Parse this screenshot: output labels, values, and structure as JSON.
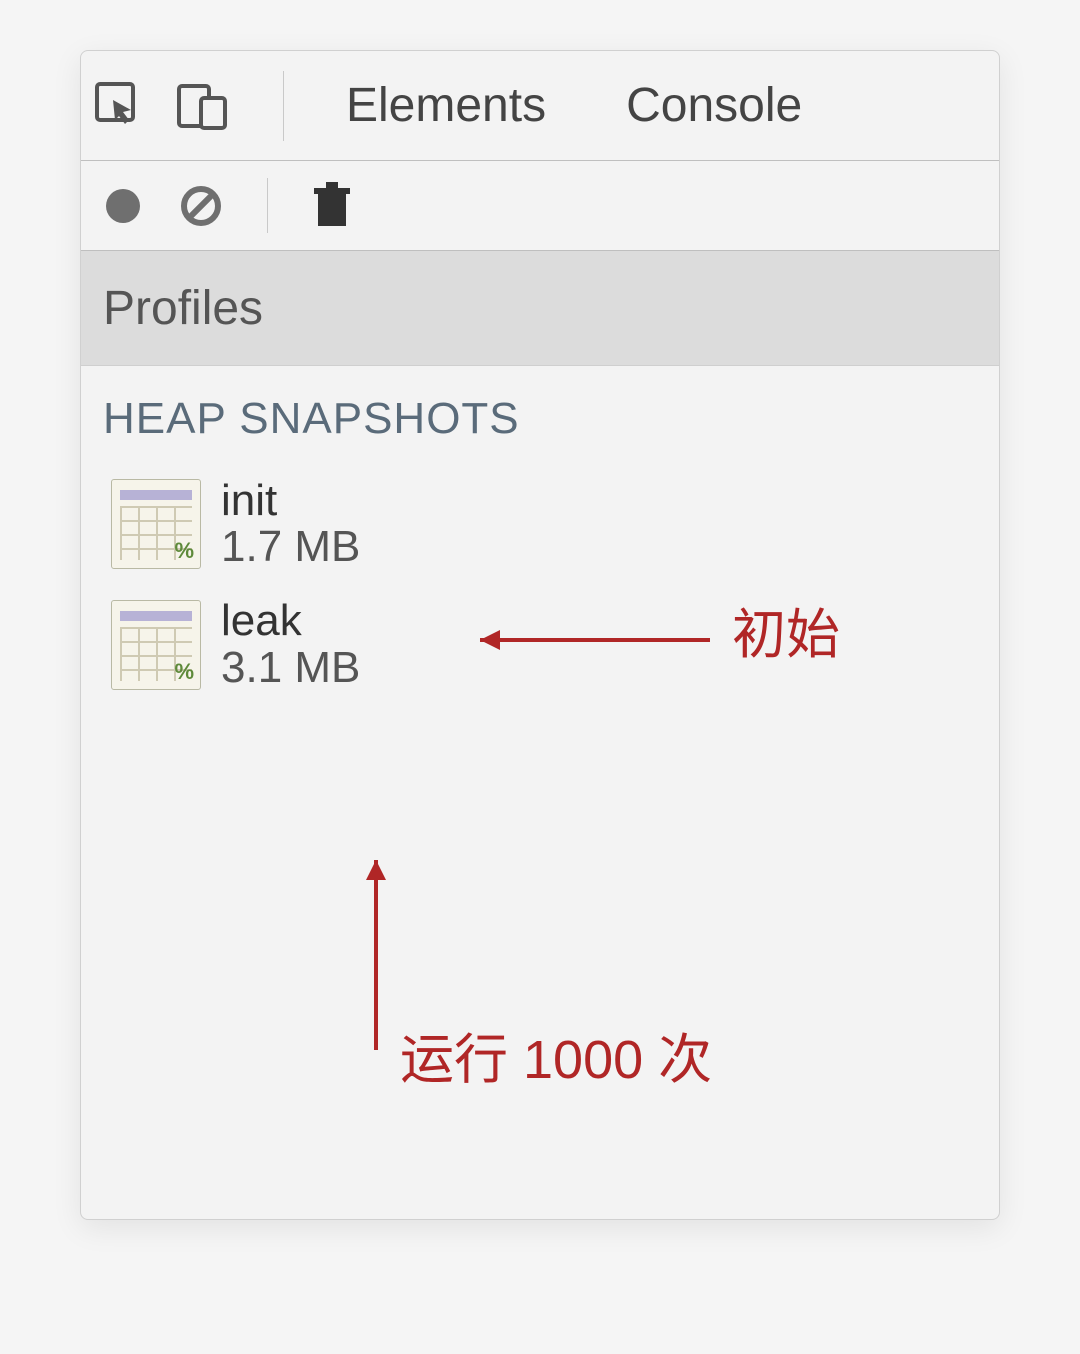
{
  "tabs": {
    "elements": "Elements",
    "console": "Console"
  },
  "section": {
    "profiles": "Profiles"
  },
  "category": {
    "heap": "HEAP SNAPSHOTS"
  },
  "snapshots": [
    {
      "name": "init",
      "size": "1.7 MB"
    },
    {
      "name": "leak",
      "size": "3.1 MB"
    }
  ],
  "annotations": {
    "initial": "初始",
    "run1000": "运行 1000 次"
  },
  "icons": {
    "inspect": "inspect-icon",
    "device": "device-icon",
    "record": "record-icon",
    "clear": "clear-icon",
    "trash": "trash-icon",
    "pct": "%"
  }
}
